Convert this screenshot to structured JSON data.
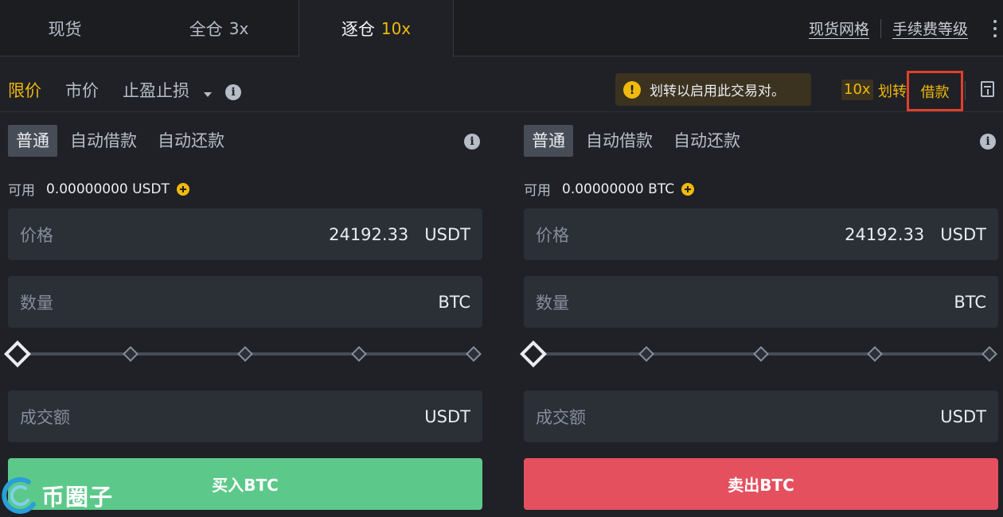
{
  "tabs": [
    {
      "label": "现货",
      "leverage": ""
    },
    {
      "label": "全仓",
      "leverage": "3x"
    },
    {
      "label": "逐仓",
      "leverage": "10x"
    }
  ],
  "top_links": {
    "grid": "现货网格",
    "fees": "手续费等级"
  },
  "order_types": {
    "limit": "限价",
    "market": "市价",
    "stop": "止盈止损"
  },
  "notice": {
    "text": "划转以启用此交易对。"
  },
  "margin": {
    "leverage": "10x",
    "transfer": "划转",
    "borrow": "借款"
  },
  "buy_panel": {
    "modes": [
      "普通",
      "自动借款",
      "自动还款"
    ],
    "available_label": "可用",
    "available_value": "0.00000000 USDT",
    "price_label": "价格",
    "price_value": "24192.33",
    "price_unit": "USDT",
    "amount_label": "数量",
    "amount_unit": "BTC",
    "total_label": "成交额",
    "total_unit": "USDT",
    "slider_percent": 0,
    "button": "买入BTC"
  },
  "sell_panel": {
    "modes": [
      "普通",
      "自动借款",
      "自动还款"
    ],
    "available_label": "可用",
    "available_value": "0.00000000 BTC",
    "price_label": "价格",
    "price_value": "24192.33",
    "price_unit": "USDT",
    "amount_label": "数量",
    "amount_unit": "BTC",
    "total_label": "成交额",
    "total_unit": "USDT",
    "slider_percent": 0,
    "button": "卖出BTC"
  },
  "watermark": {
    "text": "币圈子"
  },
  "colors": {
    "accent": "#f0b90b",
    "buy": "#5cc98a",
    "sell": "#e5505f",
    "highlight_box": "#e0402b"
  }
}
